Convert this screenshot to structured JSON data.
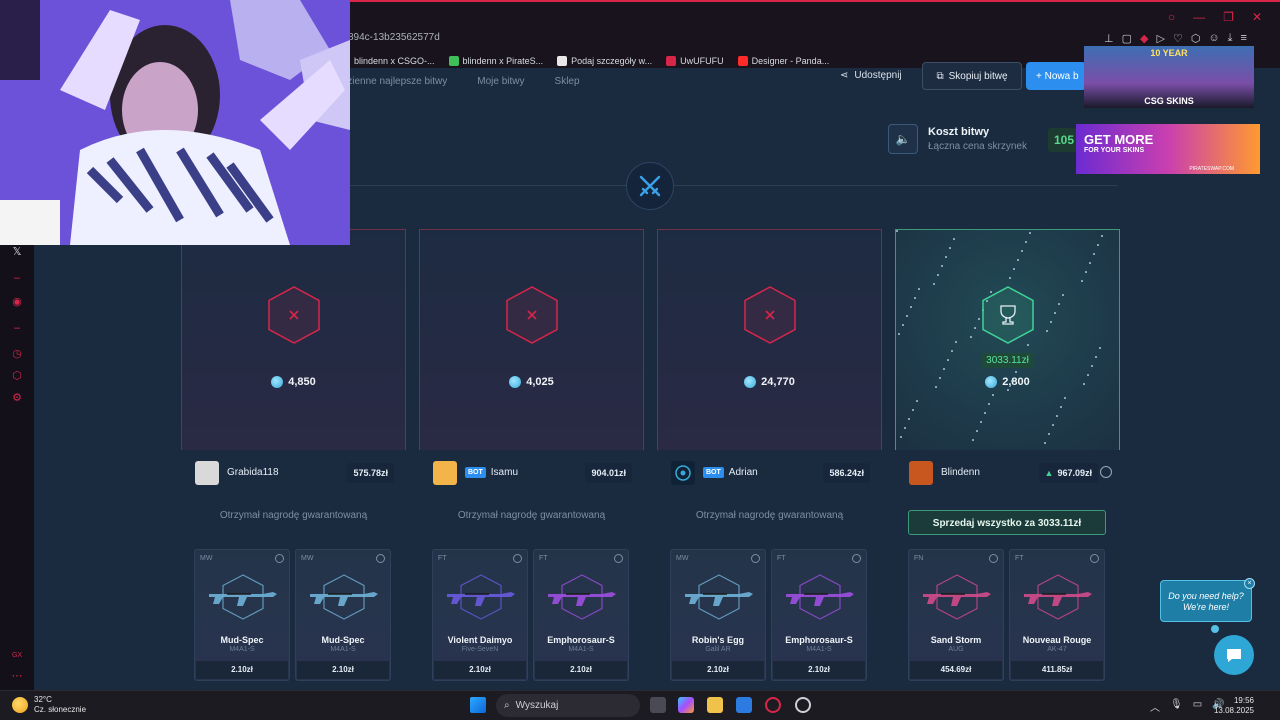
{
  "browser": {
    "address": "894c-13b23562577d",
    "bookmarks": [
      {
        "label": "blindenn x CSGO-...",
        "color": "#ffffff"
      },
      {
        "label": "blindenn x PirateS...",
        "color": "#3fbf5a"
      },
      {
        "label": "Podaj szczegóły w...",
        "color": "#e8e8e8"
      },
      {
        "label": "UwUFUFU",
        "color": "#d7264a"
      },
      {
        "label": "Designer - Panda...",
        "color": "#ff2a2a"
      }
    ],
    "sidebar_label": "GX"
  },
  "subnav": {
    "items": [
      "Dzienne najlepsze bitwy",
      "Moje bitwy",
      "Sklep"
    ]
  },
  "actions": {
    "share_label": "Udostępnij",
    "copy_label": "Skopiuj bitwę",
    "new_label": "+ Nowa b"
  },
  "battle_cost": {
    "title": "Koszt bitwy",
    "subtitle": "Łączna cena skrzynek",
    "value": "105"
  },
  "accent_colors": {
    "loss": "#d7264a",
    "win": "#3fd398",
    "bot_badge": "#2c8ff0"
  },
  "players": [
    {
      "name": "Grabida118",
      "is_bot": false,
      "total": "575.78zł",
      "coins": "4,850",
      "result": "loss",
      "reward_text": "Otrzymał nagrodę gwarantowaną",
      "items": [
        {
          "grade": "MW",
          "skin": "Mud-Spec",
          "weapon": "M4A1-S",
          "price": "2.10zł",
          "color": "#6fb2d8"
        },
        {
          "grade": "MW",
          "skin": "Mud-Spec",
          "weapon": "M4A1-S",
          "price": "2.10zł",
          "color": "#6fb2d8"
        }
      ]
    },
    {
      "name": "Isamu",
      "is_bot": true,
      "total": "904.01zł",
      "coins": "4,025",
      "result": "loss",
      "reward_text": "Otrzymał nagrodę gwarantowaną",
      "items": [
        {
          "grade": "FT",
          "skin": "Violent Daimyo",
          "weapon": "Five-SeveN",
          "price": "2.10zł",
          "color": "#6a5ae0"
        },
        {
          "grade": "FT",
          "skin": "Emphorosaur-S",
          "weapon": "M4A1-S",
          "price": "2.10zł",
          "color": "#9d4fe0"
        }
      ]
    },
    {
      "name": "Adrian",
      "is_bot": true,
      "total": "586.24zł",
      "coins": "24,770",
      "result": "loss",
      "reward_text": "Otrzymał nagrodę gwarantowaną",
      "items": [
        {
          "grade": "MW",
          "skin": "Robin's Egg",
          "weapon": "Galil AR",
          "price": "2.10zł",
          "color": "#6fb2d8"
        },
        {
          "grade": "FT",
          "skin": "Emphorosaur-S",
          "weapon": "M4A1-S",
          "price": "2.10zł",
          "color": "#9d4fe0"
        }
      ]
    },
    {
      "name": "Blindenn",
      "is_bot": false,
      "total": "967.09zł",
      "coins": "2,800",
      "result": "win",
      "win_amount": "3033.11zł",
      "sell_label": "Sprzedaj wszystko za 3033.11zł",
      "items": [
        {
          "grade": "FN",
          "skin": "Sand Storm",
          "weapon": "AUG",
          "price": "454.69zł",
          "color": "#d24a8c"
        },
        {
          "grade": "FT",
          "skin": "Nouveau Rouge",
          "weapon": "AK-47",
          "price": "411.85zł",
          "color": "#d24a8c"
        }
      ]
    }
  ],
  "ads": {
    "ad1_top": "10 YEAR",
    "ad1_label": "CSG SKINS",
    "ad2_line1": "GET MORE",
    "ad2_line2": "FOR YOUR SKINS",
    "ad2_domain": "PIRATESWAP.COM"
  },
  "chat": {
    "bubble": "Do you need help? We're here!",
    "close": "×"
  },
  "taskbar": {
    "temperature": "32°C",
    "weather": "Cz. słonecznie",
    "search_placeholder": "Wyszukaj",
    "time": "19:56",
    "date": "13.08.2025"
  }
}
